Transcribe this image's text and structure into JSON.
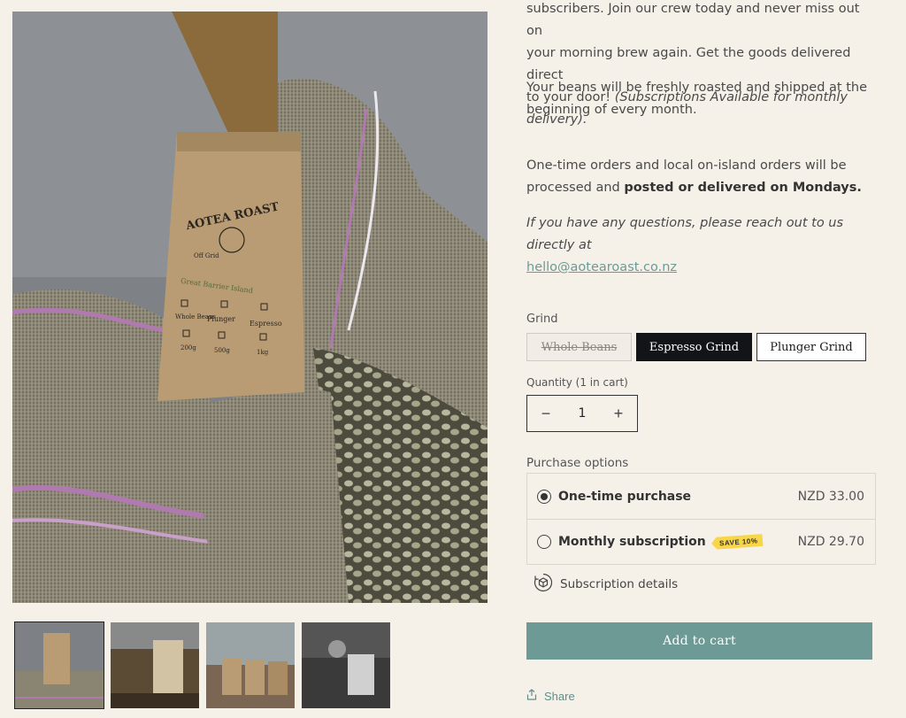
{
  "product_media": {
    "main_image_alt": "Aotea Roast coffee bag in burlap sack",
    "bag_text": {
      "brand": "AOTEA ROAST",
      "sub": "Off Grid",
      "island": "Great Barrier Island",
      "checkboxes": [
        "Whole Beans",
        "Plunger",
        "Espresso"
      ],
      "weights": [
        "200g",
        "500g",
        "1kg"
      ]
    },
    "thumbnails": [
      "thumb-1",
      "thumb-2",
      "thumb-3",
      "thumb-4"
    ]
  },
  "description": {
    "p1_line1": "subscribers. Join our crew today and never miss out on",
    "p1_line2": "your morning brew again. Get the goods delivered direct",
    "p1_line3_plain": "to your door! ",
    "p1_line3_italic": "(Subscriptions Available for monthly delivery).",
    "p2_line1": "Your beans will be freshly roasted and shipped at the",
    "p2_line2": "beginning of every month.",
    "p3_line1": "One-time orders and local on-island orders will be",
    "p3_line2_plain": "processed and ",
    "p3_line2_bold": "posted or delivered on Mondays.",
    "p4_line1": "If you have any questions, please reach out to us directly at",
    "email": "hello@aotearoast.co.nz"
  },
  "grind": {
    "label": "Grind",
    "options": [
      "Whole Beans",
      "Espresso Grind",
      "Plunger Grind"
    ],
    "selected": "Espresso Grind",
    "disabled": "Whole Beans"
  },
  "quantity": {
    "label": "Quantity (1 in cart)",
    "value": "1",
    "minus": "−",
    "plus": "+"
  },
  "purchase": {
    "label": "Purchase options",
    "one_time": {
      "name": "One-time purchase",
      "price": "NZD 33.00"
    },
    "monthly": {
      "name": "Monthly subscription",
      "badge": "SAVE 10%",
      "price": "NZD 29.70"
    },
    "details": "Subscription details"
  },
  "add_to_cart": "Add to cart",
  "share": "Share",
  "colors": {
    "background": "#f5f0e8",
    "accent": "#6e9a95",
    "selected": "#121418",
    "badge": "#f7d64a"
  }
}
